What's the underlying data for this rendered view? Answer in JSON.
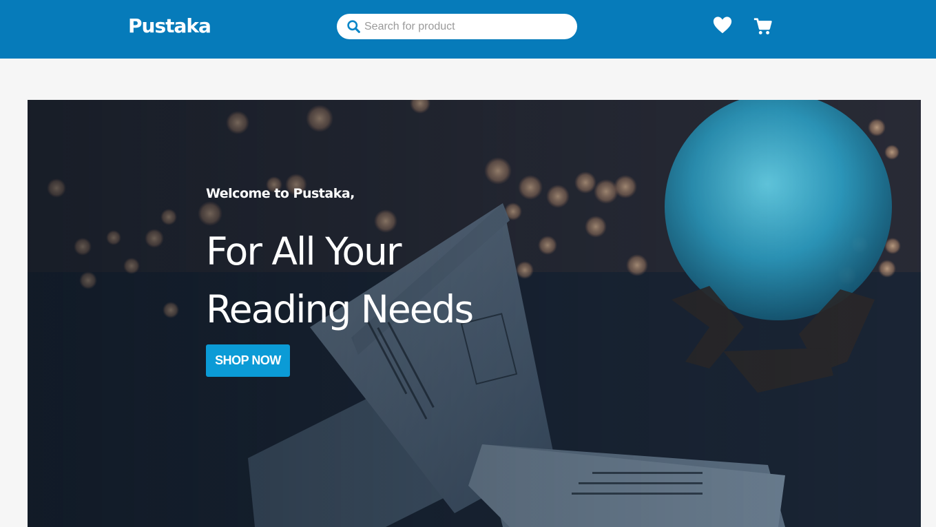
{
  "header": {
    "logo": "Pustaka",
    "search": {
      "placeholder": "Search for product",
      "value": ""
    },
    "icons": [
      "heart-icon",
      "cart-icon",
      "search-icon"
    ],
    "accent_color": "#067bba"
  },
  "hero": {
    "welcome": "Welcome to Pustaka,",
    "title_line1": "For All Your",
    "title_line2": "Reading Needs",
    "cta_label": "SHOP NOW",
    "cta_color": "#0b9bd6"
  }
}
